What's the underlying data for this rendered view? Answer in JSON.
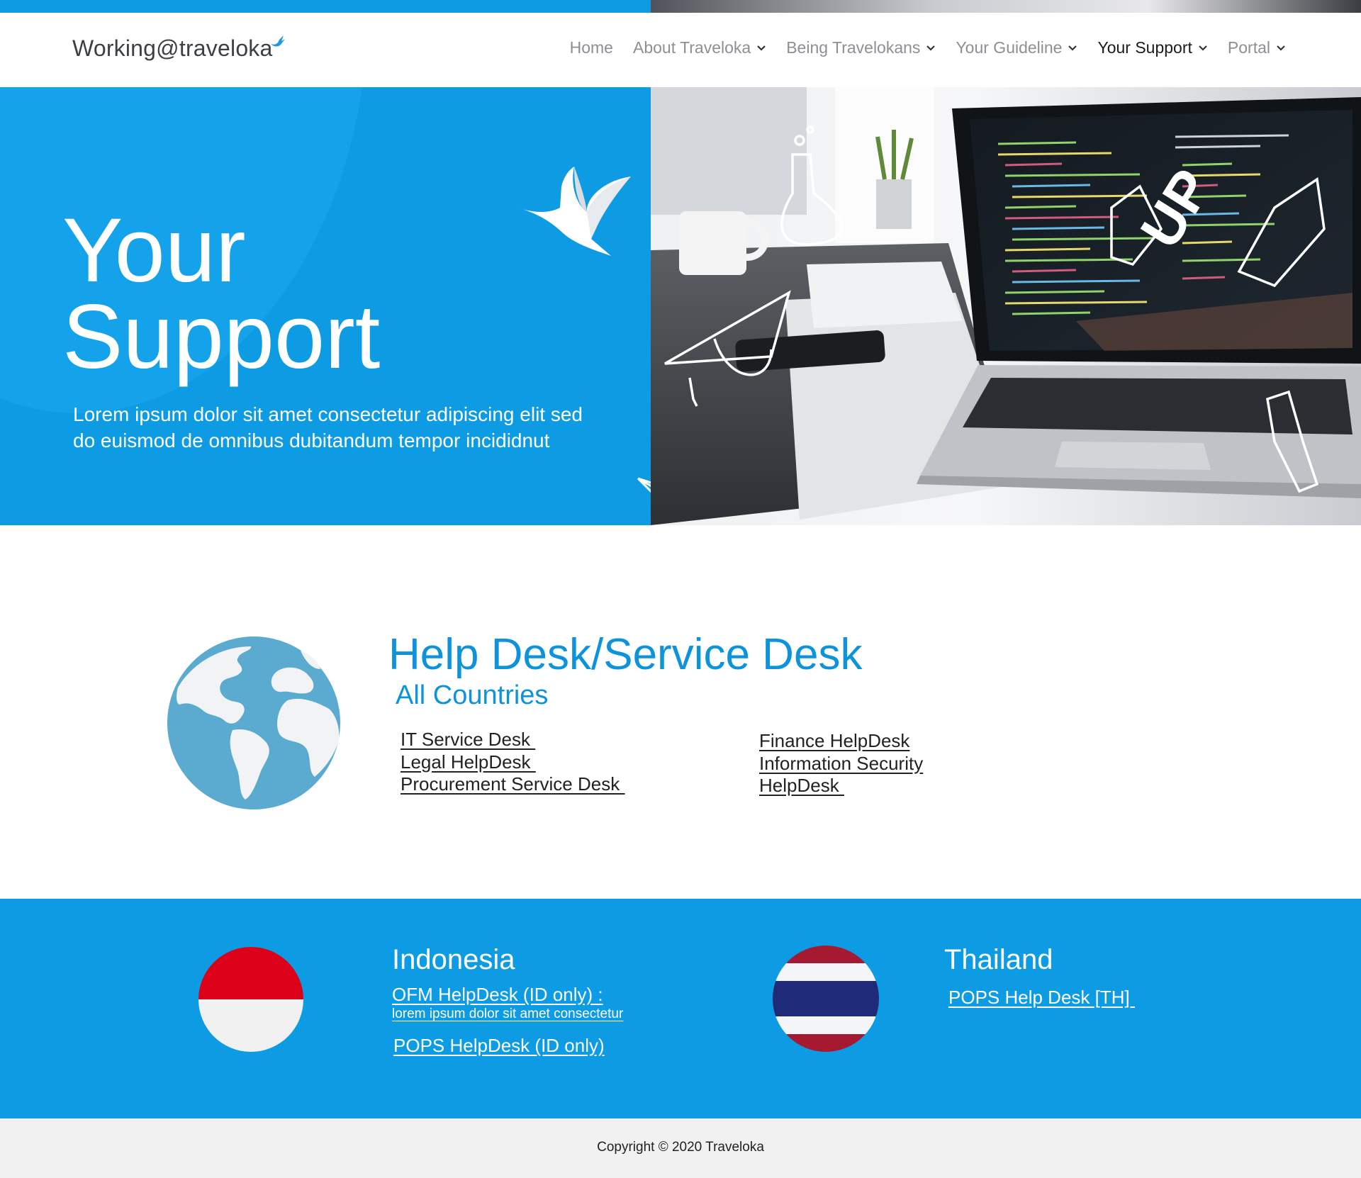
{
  "header": {
    "logo": "Working@traveloka",
    "nav": [
      {
        "label": "Home",
        "has_dropdown": false,
        "active": false
      },
      {
        "label": "About Traveloka",
        "has_dropdown": true,
        "active": false
      },
      {
        "label": "Being Travelokans",
        "has_dropdown": true,
        "active": false
      },
      {
        "label": "Your Guideline",
        "has_dropdown": true,
        "active": false
      },
      {
        "label": "Your Support",
        "has_dropdown": true,
        "active": true
      },
      {
        "label": "Portal",
        "has_dropdown": true,
        "active": false
      }
    ]
  },
  "hero": {
    "title_line1": "Your",
    "title_line2": "Support",
    "subtitle_line1": "Lorem ipsum dolor sit amet consectetur adipiscing elit  sed",
    "subtitle_line2": "do euismod de omnibus dubitandum tempor incididnut"
  },
  "helpdesk": {
    "title": "Help Desk/Service Desk",
    "subtitle": "All Countries",
    "links_left": [
      "IT Service Desk ",
      "Legal HelpDesk ",
      "Procurement Service Desk "
    ],
    "links_right": [
      "Finance HelpDesk",
      "Information Security",
      "HelpDesk "
    ]
  },
  "countries": {
    "indonesia": {
      "name": "Indonesia",
      "link1": "OFM HelpDesk (ID only) :",
      "link1_sub": "lorem ipsum dolor sit amet consectetur",
      "link2": "POPS HelpDesk (ID only)"
    },
    "thailand": {
      "name": "Thailand",
      "link1": "POPS Help Desk [TH] "
    }
  },
  "footer": {
    "copyright": "Copyright © 2020 Traveloka"
  },
  "colors": {
    "brand_blue": "#0d9be3",
    "heading_blue": "#0d93dc",
    "indonesia_red": "#dd0019",
    "thailand_red": "#a51931",
    "thailand_blue": "#1f2a78"
  }
}
